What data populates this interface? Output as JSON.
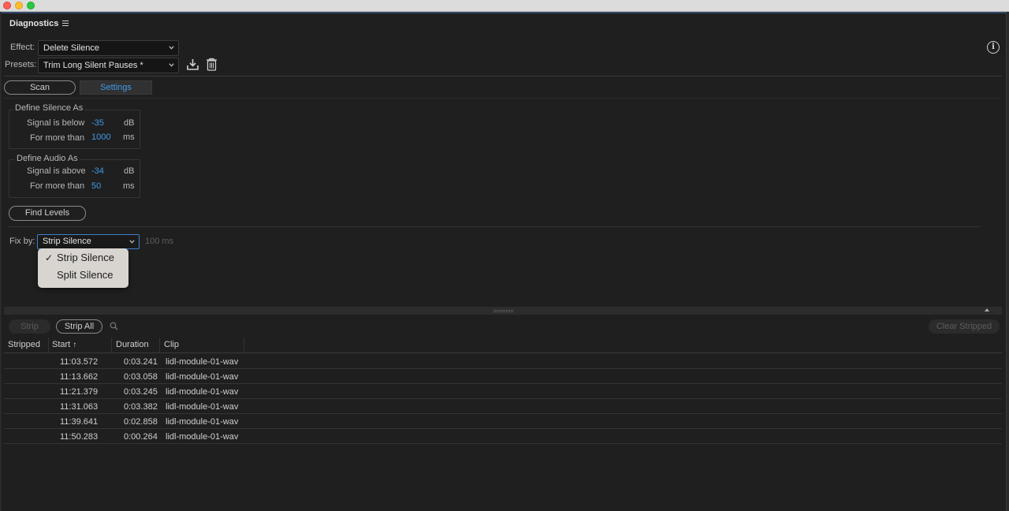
{
  "panel": {
    "title": "Diagnostics"
  },
  "effect": {
    "label": "Effect:",
    "value": "Delete Silence"
  },
  "presets": {
    "label": "Presets:",
    "value": "Trim Long Silent Pauses *"
  },
  "tabs": {
    "scan": "Scan",
    "settings": "Settings"
  },
  "silence": {
    "title": "Define Silence As",
    "signal_label": "Signal is below",
    "signal_value": "-35",
    "signal_unit": "dB",
    "duration_label": "For more than",
    "duration_value": "1000",
    "duration_unit": "ms"
  },
  "audio": {
    "title": "Define Audio As",
    "signal_label": "Signal is above",
    "signal_value": "-34",
    "signal_unit": "dB",
    "duration_label": "For more than",
    "duration_value": "50",
    "duration_unit": "ms"
  },
  "find_levels": "Find Levels",
  "fix_by": {
    "label": "Fix by:",
    "value": "Strip Silence",
    "extra": "100 ms",
    "options": [
      "Strip Silence",
      "Split Silence"
    ],
    "checkmark": "✓"
  },
  "toolbar": {
    "strip": "Strip",
    "strip_all": "Strip All",
    "clear_stripped": "Clear Stripped"
  },
  "table": {
    "headers": {
      "stripped": "Stripped",
      "start": "Start",
      "sort_arrow": "↑",
      "duration": "Duration",
      "clip": "Clip"
    },
    "rows": [
      {
        "start": "11:03.572",
        "duration": "0:03.241",
        "clip": "lidl-module-01-wav"
      },
      {
        "start": "11:13.662",
        "duration": "0:03.058",
        "clip": "lidl-module-01-wav"
      },
      {
        "start": "11:21.379",
        "duration": "0:03.245",
        "clip": "lidl-module-01-wav"
      },
      {
        "start": "11:31.063",
        "duration": "0:03.382",
        "clip": "lidl-module-01-wav"
      },
      {
        "start": "11:39.641",
        "duration": "0:02.858",
        "clip": "lidl-module-01-wav"
      },
      {
        "start": "11:50.283",
        "duration": "0:00.264",
        "clip": "lidl-module-01-wav"
      }
    ]
  },
  "colors": {
    "accent": "#3f9ae8",
    "panel_bg": "#1f1f1f"
  },
  "icons": {
    "panel_menu": "hamburger-menu-icon",
    "info": "info-icon",
    "save_preset": "download-icon",
    "delete_preset": "trash-icon",
    "search": "search-icon"
  }
}
